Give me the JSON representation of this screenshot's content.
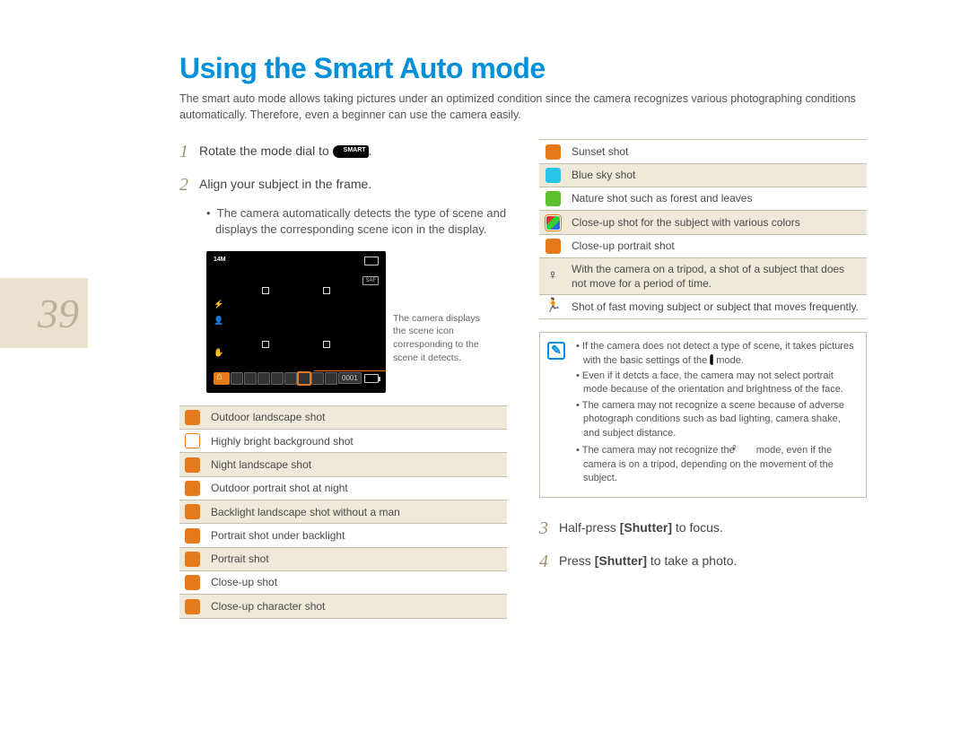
{
  "page_number": "39",
  "title": "Using the Smart Auto mode",
  "intro": "The smart auto mode allows taking pictures under an optimized condition since the camera recognizes various photographing conditions automatically. Therefore, even a beginner can use the camera easily.",
  "steps": {
    "s1_pre": "Rotate the mode dial to ",
    "s1_post": ".",
    "s2": "Align your subject in the frame.",
    "s2_sub": "The camera automatically detects the type of scene and displays the corresponding scene icon in the display.",
    "s3_pre": "Half-press ",
    "s3_bold": "[Shutter]",
    "s3_post": " to focus.",
    "s4_pre": "Press ",
    "s4_bold": "[Shutter]",
    "s4_post": " to take a photo."
  },
  "lcd": {
    "resolution": "14M",
    "saf": "SAF",
    "counter": "0001",
    "caption": "The camera displays the scene icon corresponding to the scene it detects."
  },
  "left_table": [
    "Outdoor landscape shot",
    "Highly bright background shot",
    "Night landscape shot",
    "Outdoor portrait shot at night",
    "Backlight landscape shot without a man",
    "Portrait shot under backlight",
    "Portrait shot",
    "Close-up shot",
    "Close-up character shot"
  ],
  "right_table": [
    "Sunset shot",
    "Blue sky shot",
    "Nature shot such as forest and leaves",
    "Close-up shot for the subject with various colors",
    "Close-up portrait shot",
    "With the camera on a tripod, a shot of a subject that does not move for a period of time.",
    "Shot of fast moving subject or subject that moves frequently."
  ],
  "notes": {
    "n1_a": "If the camera does not detect a type of scene, it takes pictures with the basic settings of the ",
    "n1_b": " mode.",
    "n2": "Even if it detcts a face, the camera may not select portrait mode because of the orientation and brightness of the face.",
    "n3": "The camera may not recognize a scene because of adverse photograph conditions such as bad lighting, camera shake, and subject distance.",
    "n4_a": "The camera may not recognize the ",
    "n4_b": " mode, even if the camera is on a tripod, depending on the movement of the subject."
  },
  "labels": {
    "smart": "SMART"
  }
}
